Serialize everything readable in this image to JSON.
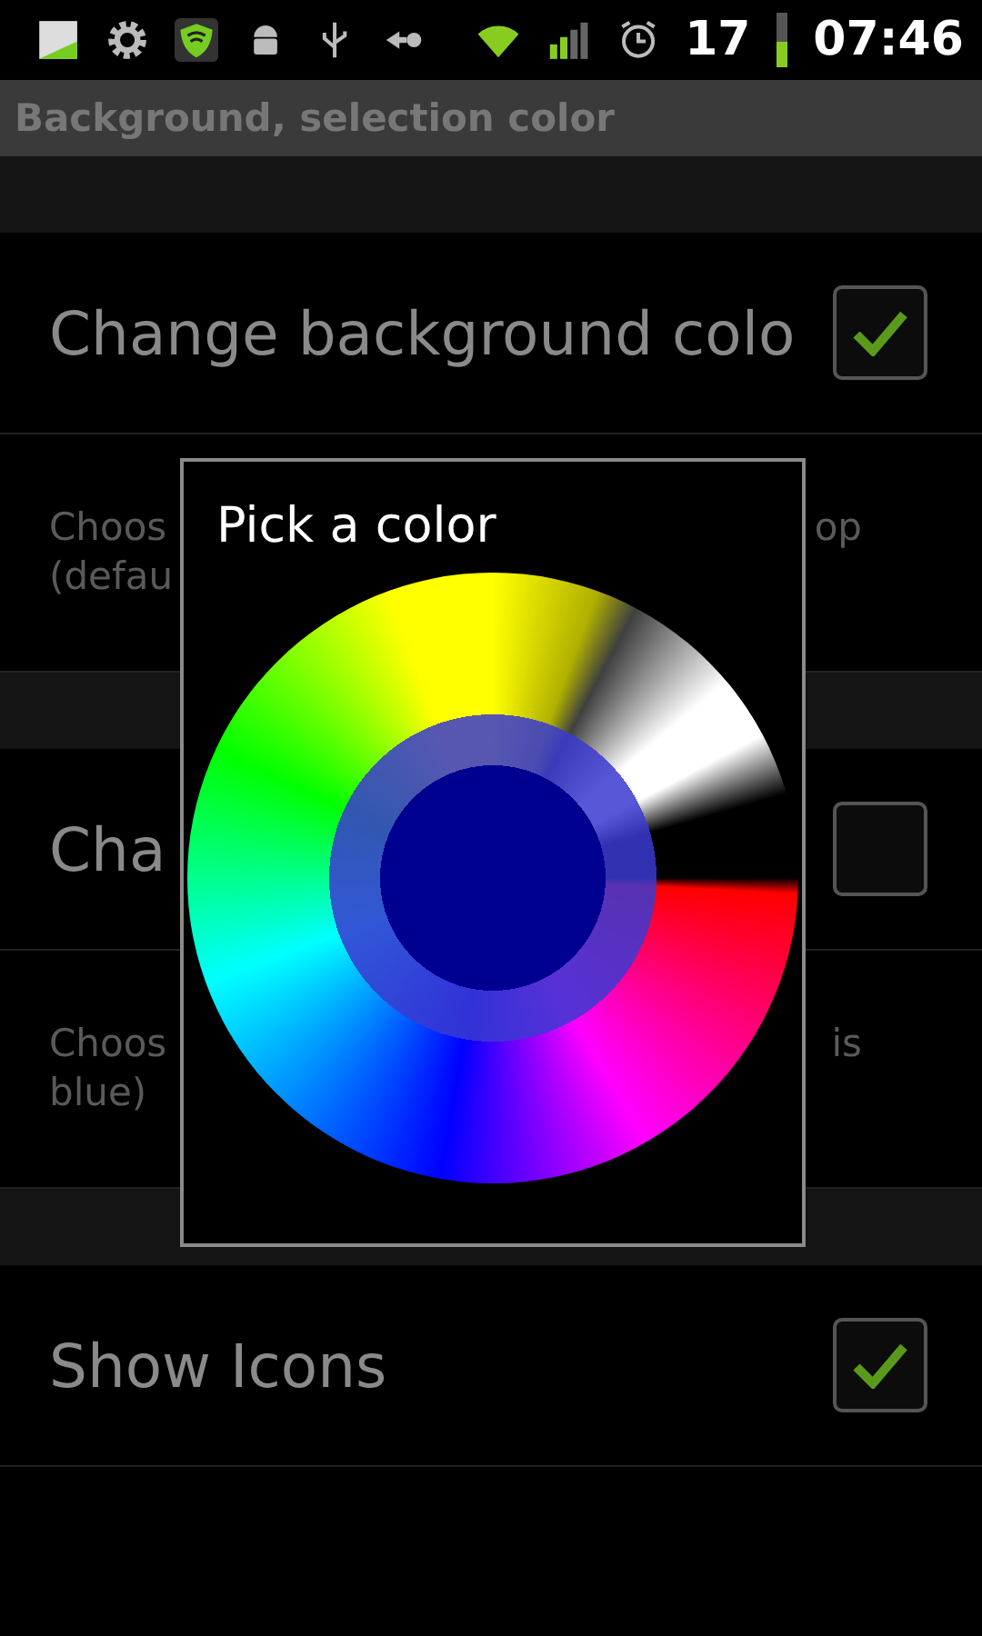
{
  "status_bar": {
    "battery": "17",
    "time": "07:46"
  },
  "title": "Background, selection color",
  "items": [
    {
      "kind": "category"
    },
    {
      "kind": "check",
      "title": "Change background colo",
      "checked": true
    },
    {
      "kind": "summary",
      "lines": [
        {
          "left": "Choos",
          "right": "op"
        },
        {
          "left": "(defau"
        }
      ]
    },
    {
      "kind": "category"
    },
    {
      "kind": "check",
      "title": "Cha",
      "checked": false
    },
    {
      "kind": "summary",
      "lines": [
        {
          "left": "Choos",
          "right": "is"
        },
        {
          "left": "blue)"
        }
      ]
    },
    {
      "kind": "category"
    },
    {
      "kind": "check",
      "title": "Show Icons",
      "checked": true
    }
  ],
  "dialog": {
    "title": "Pick a color"
  }
}
